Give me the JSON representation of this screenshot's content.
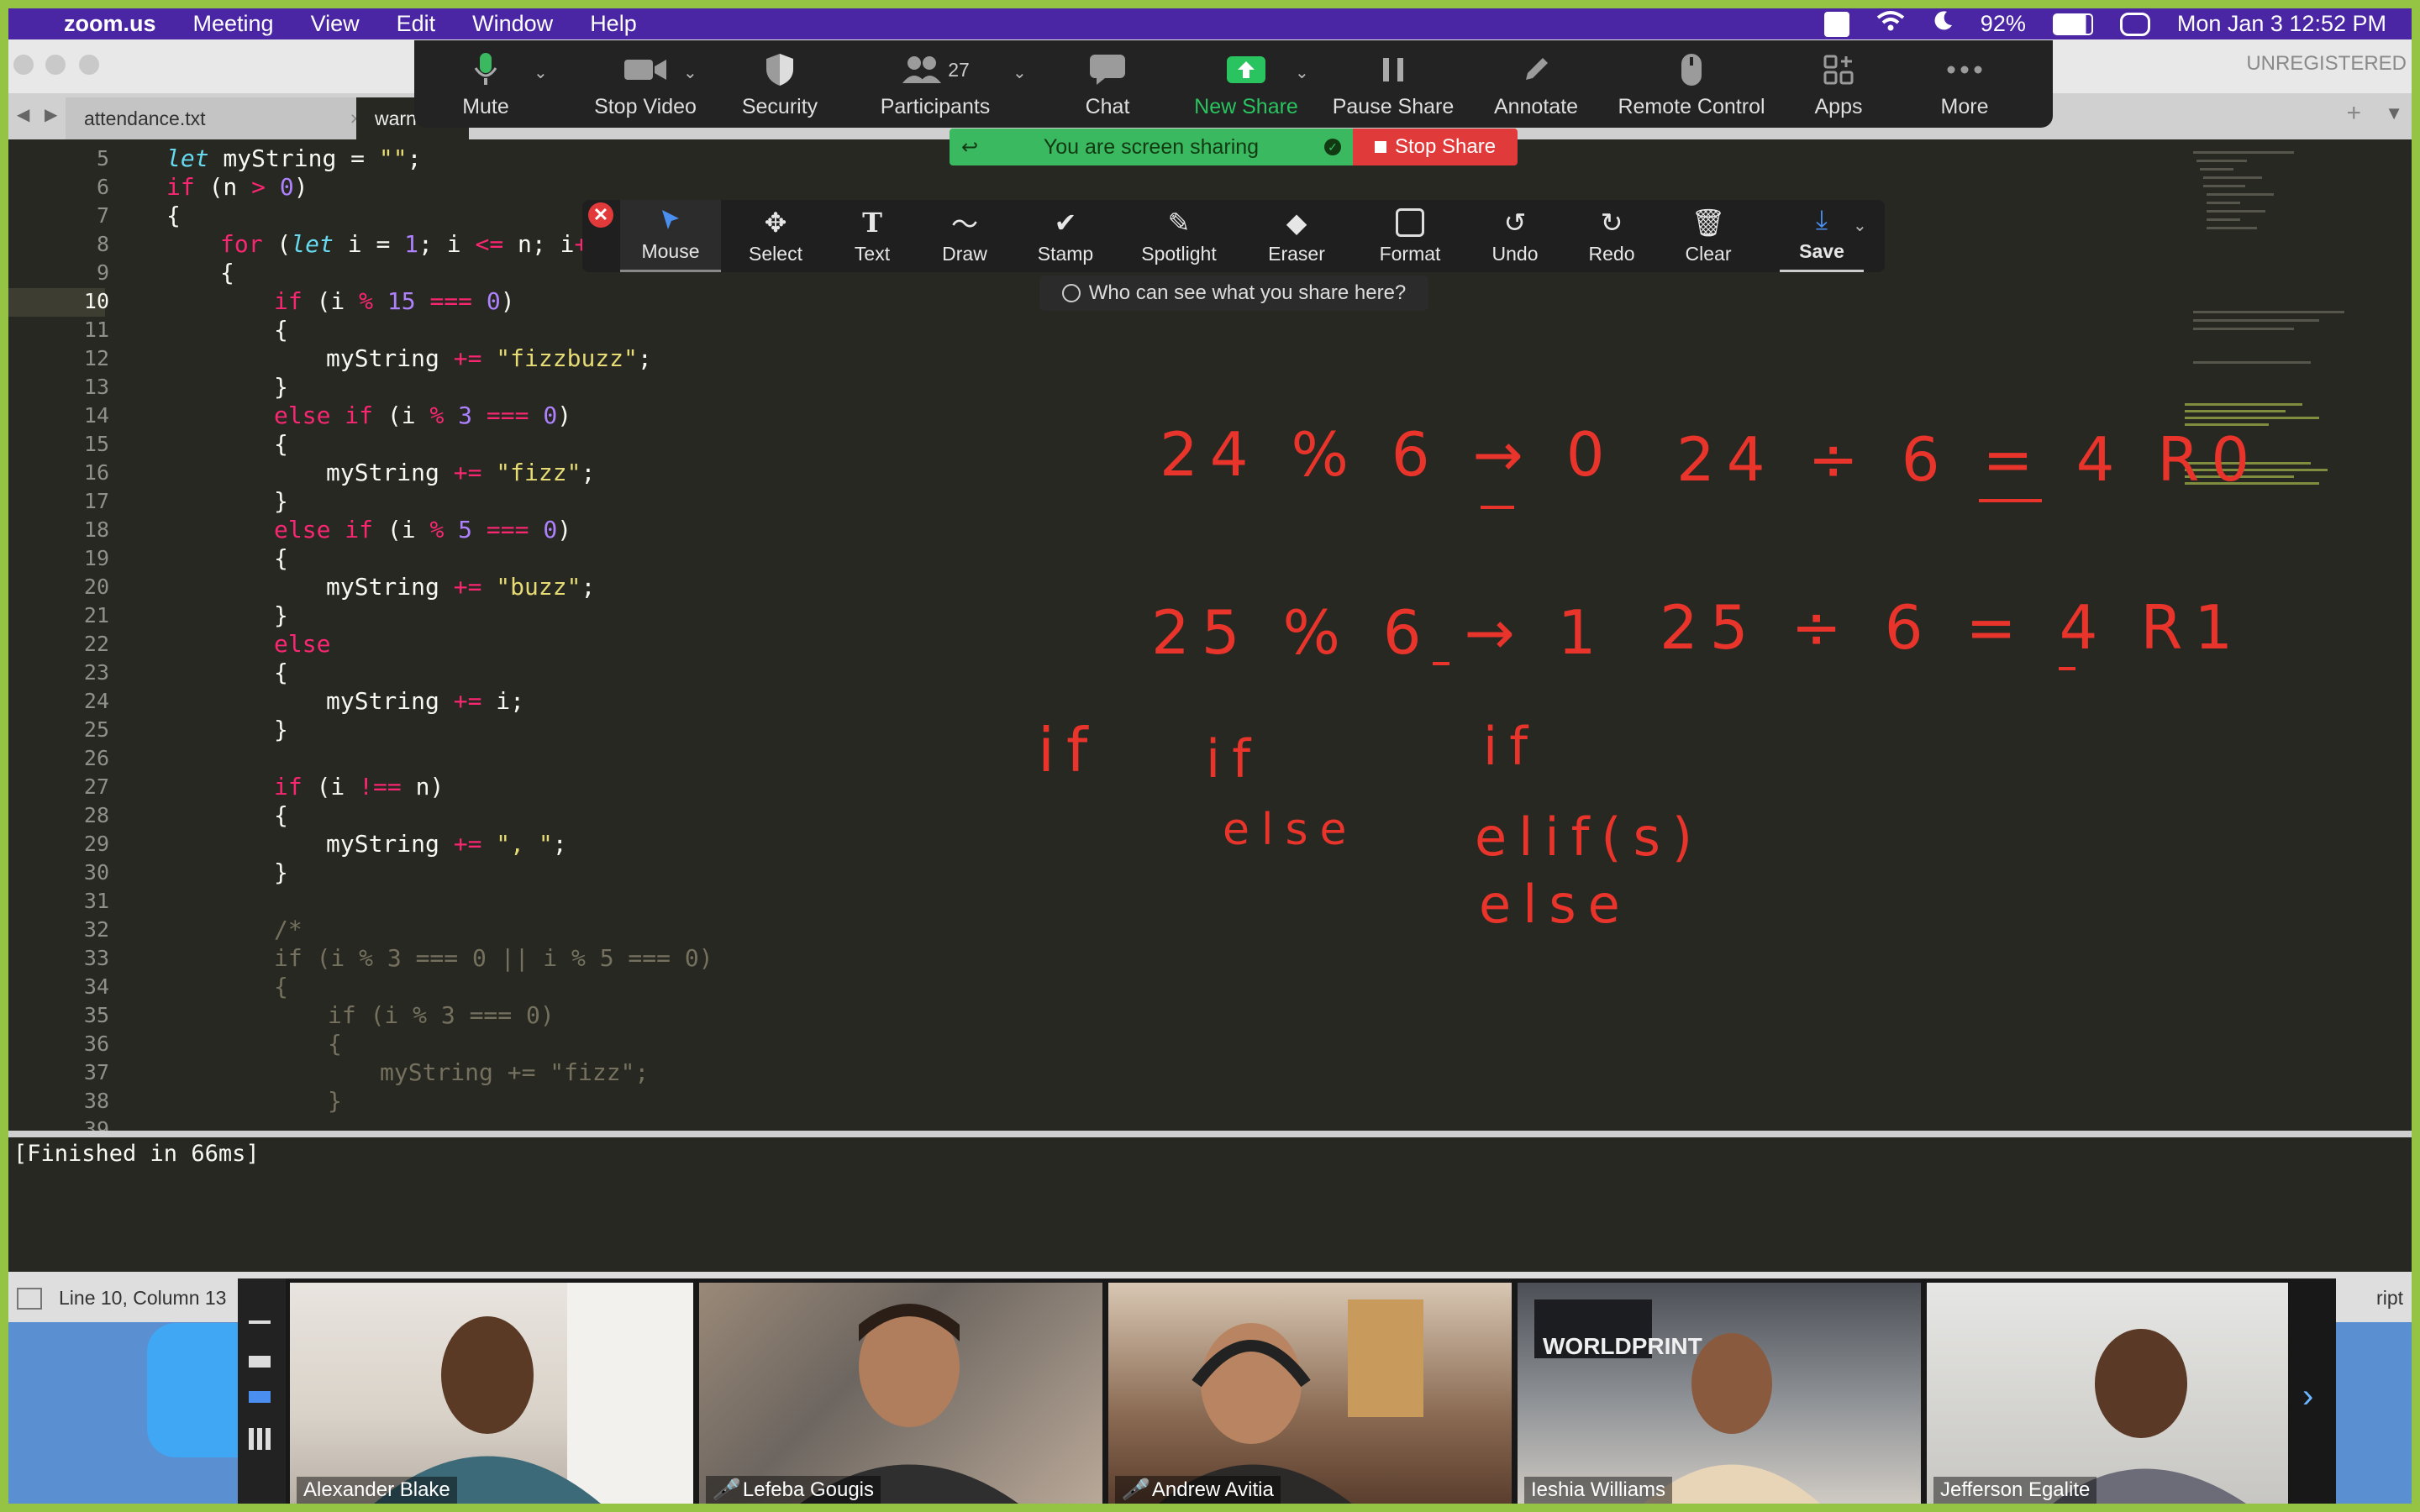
{
  "menubar": {
    "apple": "",
    "app": "zoom.us",
    "items": [
      "Meeting",
      "View",
      "Edit",
      "Window",
      "Help"
    ],
    "battery": "92%",
    "datetime": "Mon Jan 3  12:52 PM"
  },
  "editor": {
    "unregistered": "UNREGISTERED",
    "tabs": [
      {
        "label": "attendance.txt",
        "close": "×"
      },
      {
        "label": "warn"
      }
    ],
    "tab_add": "+",
    "line_numbers": [
      "5",
      "6",
      "7",
      "8",
      "9",
      "10",
      "11",
      "12",
      "13",
      "14",
      "15",
      "16",
      "17",
      "18",
      "19",
      "20",
      "21",
      "22",
      "23",
      "24",
      "25",
      "26",
      "27",
      "28",
      "29",
      "30",
      "31",
      "32",
      "33",
      "34",
      "35",
      "36",
      "37",
      "38",
      "39"
    ],
    "current_line": "10",
    "output": "[Finished in 66ms]",
    "status": "Line 10, Column 13",
    "status_right": "ript"
  },
  "zoom_toolbar": {
    "mute": "Mute",
    "stop_video": "Stop Video",
    "security": "Security",
    "participants": "Participants",
    "participants_count": "27",
    "chat": "Chat",
    "new_share": "New Share",
    "pause_share": "Pause Share",
    "annotate": "Annotate",
    "remote_control": "Remote Control",
    "apps": "Apps",
    "more": "More"
  },
  "share_banner": {
    "status": "You are screen sharing",
    "stop": "Stop Share"
  },
  "annotation_bar": {
    "mouse": "Mouse",
    "select": "Select",
    "text": "Text",
    "draw": "Draw",
    "stamp": "Stamp",
    "spotlight": "Spotlight",
    "eraser": "Eraser",
    "format": "Format",
    "undo": "Undo",
    "redo": "Redo",
    "clear": "Clear",
    "save": "Save",
    "who_can_see": "Who can see what you share here?"
  },
  "annotations": {
    "line1_left": "24 % 6 → 0",
    "line1_right": "24 ÷ 6 = 4 R0",
    "line2_left": "25 % 6 → 1",
    "line2_right": "25 ÷ 6 = 4 R1",
    "if1": "if",
    "if2": "if",
    "else2": "else",
    "if3": "if",
    "elif3": "elif(s)",
    "else3": "else",
    "ink_color": "#e8342b"
  },
  "participants": [
    {
      "name": "Alexander Blake",
      "muted": false
    },
    {
      "name": "Lefeba Gougis",
      "muted": true
    },
    {
      "name": "Andrew Avitia",
      "muted": true
    },
    {
      "name": "Ieshia Williams",
      "muted": false,
      "sign": "WORLDPRINT"
    },
    {
      "name": "Jefferson Egalite",
      "muted": false
    }
  ],
  "colors": {
    "menubar": "#4a26a5",
    "border": "#95c444",
    "share_green": "#3ab961",
    "stop_red": "#e03a3a"
  }
}
